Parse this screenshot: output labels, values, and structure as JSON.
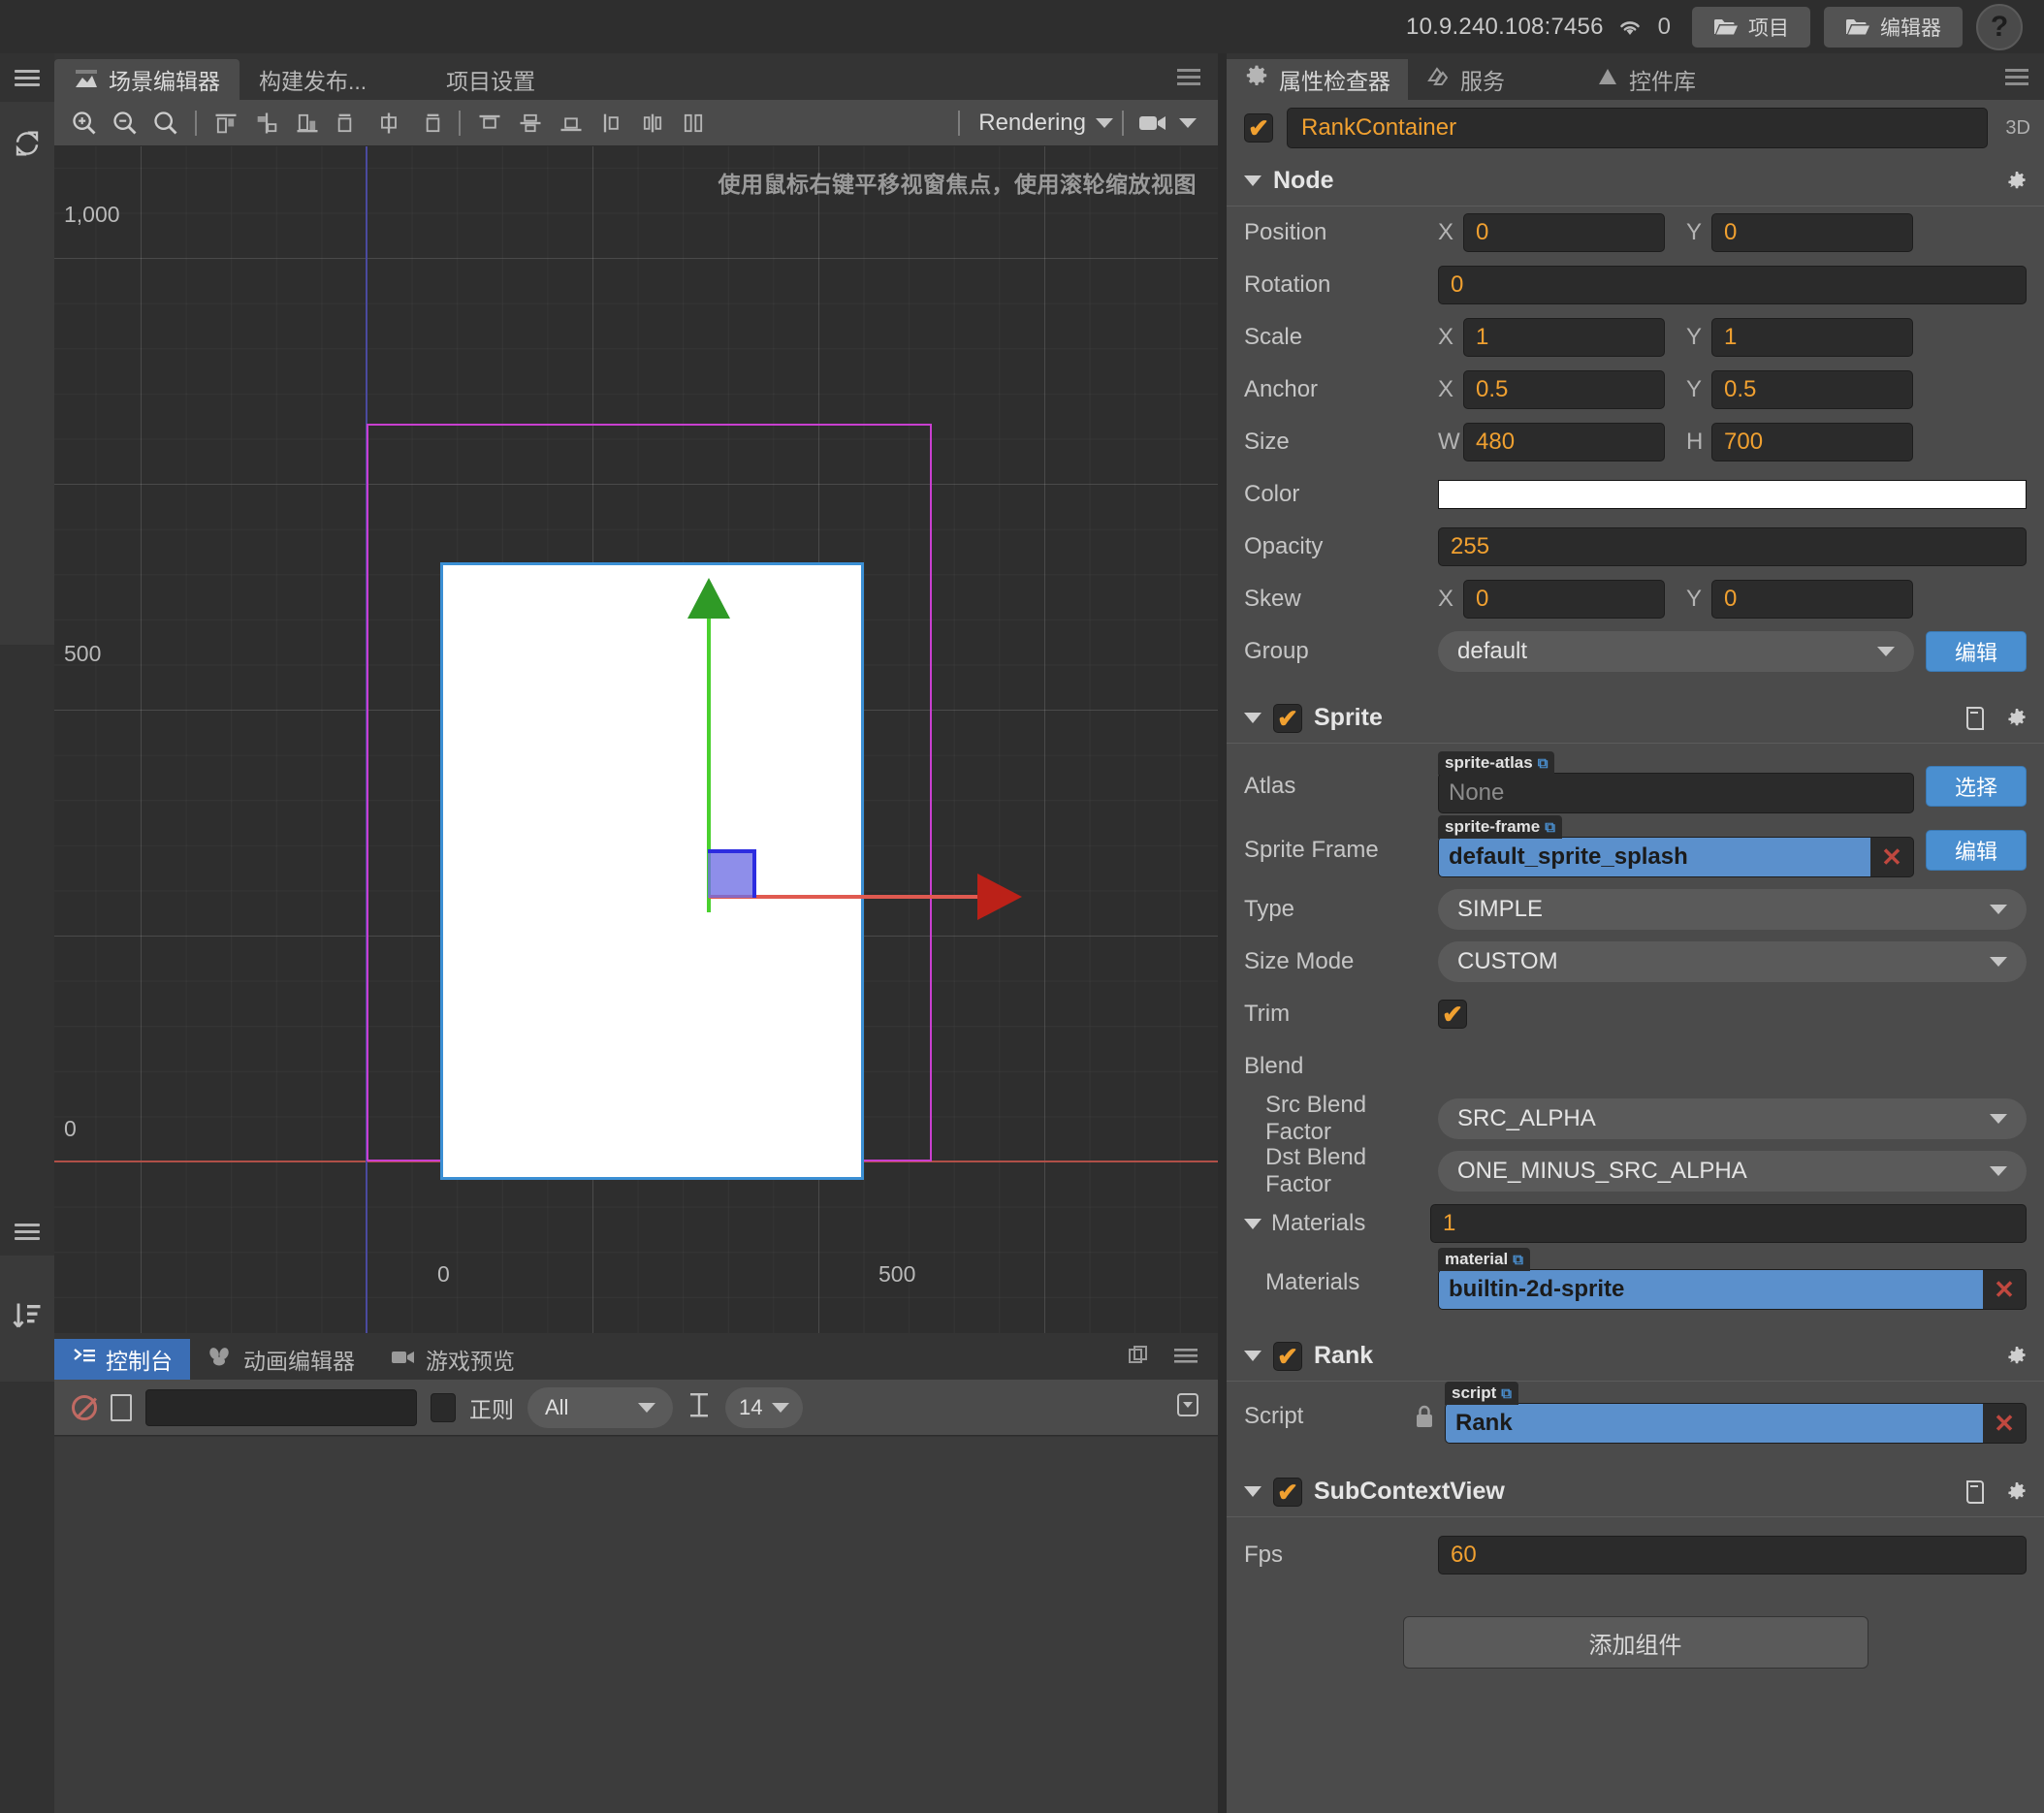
{
  "topbar": {
    "ip": "10.9.240.108:7456",
    "wifi_icon": "wifi-icon",
    "count": "0",
    "project_button": "项目",
    "editor_button": "编辑器",
    "help_button": "?"
  },
  "editor_tabs": [
    {
      "label": "场景编辑器",
      "icon": "scene-icon",
      "active": true
    },
    {
      "label": "构建发布...",
      "icon": "",
      "active": false
    },
    {
      "label": "项目设置",
      "icon": "",
      "active": false
    }
  ],
  "toolbar": {
    "icons": [
      "zoom-in-icon",
      "zoom-out-icon",
      "zoom-fit-icon",
      "align-left-icon",
      "align-center-h-icon",
      "align-right-icon",
      "distribute-left-icon",
      "distribute-center-icon",
      "distribute-right-icon",
      "align-top-icon",
      "align-middle-icon",
      "align-bottom-icon",
      "distribute-h-icon",
      "distribute-v-icon",
      "distribute-both-icon"
    ],
    "rendering_label": "Rendering",
    "camera_icon": "camera-icon"
  },
  "canvas": {
    "hint": "使用鼠标右键平移视窗焦点，使用滚轮缩放视图",
    "y_ticks": [
      "1,000",
      "500",
      "0"
    ],
    "x_ticks": [
      "0",
      "500"
    ],
    "gizmo": {
      "x_axis_color": "#e05a50",
      "y_axis_color": "#4ad02e",
      "handle_color": "#6e6ee4"
    },
    "design_rect_color": "#c93fd0",
    "node_border_color": "#3b8fd4"
  },
  "console_tabs": [
    {
      "label": "控制台",
      "icon": "console-icon",
      "active": true
    },
    {
      "label": "动画编辑器",
      "icon": "animation-icon",
      "active": false
    },
    {
      "label": "游戏预览",
      "icon": "game-preview-icon",
      "active": false
    }
  ],
  "console_tools": {
    "clear_icon": "clear-icon",
    "file_icon": "file-icon",
    "search_value": "",
    "search_placeholder": "",
    "regex_label": "正则",
    "filter_value": "All",
    "text_size_icon": "text-size-icon",
    "font_size_value": "14"
  },
  "inspector_tabs": [
    {
      "label": "属性检查器",
      "icon": "gear-icon",
      "active": true
    },
    {
      "label": "服务",
      "icon": "services-icon",
      "active": false
    },
    {
      "label": "控件库",
      "icon": "widget-library-icon",
      "active": false
    }
  ],
  "node": {
    "name": "RankContainer",
    "enabled": true,
    "three_d_label": "3D",
    "section_title": "Node",
    "position": {
      "label": "Position",
      "x_label": "X",
      "x": "0",
      "y_label": "Y",
      "y": "0"
    },
    "rotation": {
      "label": "Rotation",
      "value": "0"
    },
    "scale": {
      "label": "Scale",
      "x_label": "X",
      "x": "1",
      "y_label": "Y",
      "y": "1"
    },
    "anchor": {
      "label": "Anchor",
      "x_label": "X",
      "x": "0.5",
      "y_label": "Y",
      "y": "0.5"
    },
    "size": {
      "label": "Size",
      "w_label": "W",
      "w": "480",
      "h_label": "H",
      "h": "700"
    },
    "color": {
      "label": "Color",
      "value": "#ffffff"
    },
    "opacity": {
      "label": "Opacity",
      "value": "255"
    },
    "skew": {
      "label": "Skew",
      "x_label": "X",
      "x": "0",
      "y_label": "Y",
      "y": "0"
    },
    "group": {
      "label": "Group",
      "value": "default",
      "edit_button": "编辑"
    }
  },
  "sprite": {
    "section_title": "Sprite",
    "enabled": true,
    "atlas": {
      "label": "Atlas",
      "tag": "sprite-atlas",
      "value": "None",
      "button": "选择"
    },
    "sprite_frame": {
      "label": "Sprite Frame",
      "tag": "sprite-frame",
      "value": "default_sprite_splash",
      "button": "编辑"
    },
    "type": {
      "label": "Type",
      "value": "SIMPLE"
    },
    "size_mode": {
      "label": "Size Mode",
      "value": "CUSTOM"
    },
    "trim": {
      "label": "Trim",
      "checked": true
    },
    "blend": {
      "label": "Blend"
    },
    "src_blend_factor": {
      "label": "Src Blend Factor",
      "value": "SRC_ALPHA"
    },
    "dst_blend_factor": {
      "label": "Dst Blend Factor",
      "value": "ONE_MINUS_SRC_ALPHA"
    },
    "materials_count": {
      "label": "Materials",
      "value": "1"
    },
    "materials_item": {
      "label": "Materials",
      "tag": "material",
      "value": "builtin-2d-sprite"
    }
  },
  "rank": {
    "section_title": "Rank",
    "enabled": true,
    "script": {
      "label": "Script",
      "tag": "script",
      "value": "Rank",
      "lock_icon": "lock-icon"
    }
  },
  "subcontextview": {
    "section_title": "SubContextView",
    "enabled": true,
    "fps": {
      "label": "Fps",
      "value": "60"
    }
  },
  "add_component_button": "添加组件",
  "colors": {
    "accent_orange": "#f0a030",
    "accent_blue": "#4a8fd0",
    "asset_blue": "#5b90cc",
    "panel_bg": "#4b4b4b",
    "field_bg": "#2b2b2b",
    "remove_red": "#c0483f"
  }
}
